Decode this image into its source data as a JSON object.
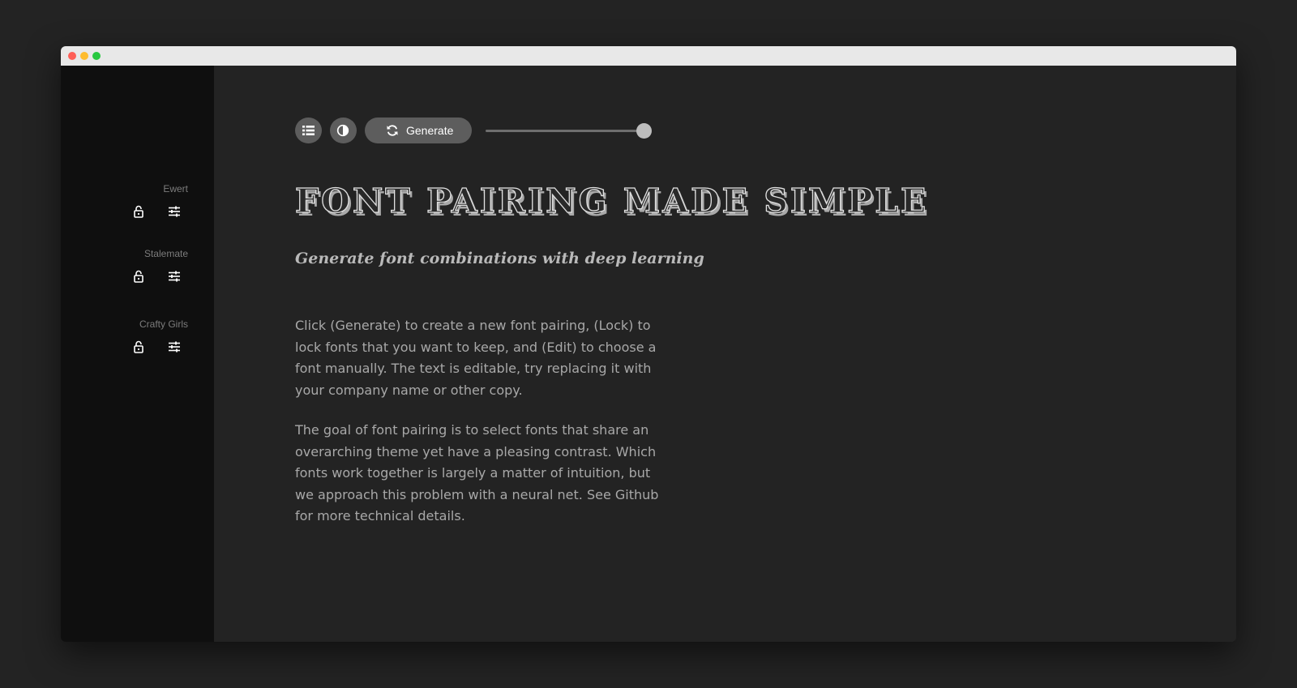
{
  "window": {
    "traffic_lights": [
      "close",
      "minimize",
      "maximize"
    ]
  },
  "sidebar": {
    "fonts": [
      {
        "name": "Ewert",
        "lock_icon": "lock-open-icon",
        "edit_icon": "sliders-icon"
      },
      {
        "name": "Stalemate",
        "lock_icon": "lock-open-icon",
        "edit_icon": "sliders-icon"
      },
      {
        "name": "Crafty Girls",
        "lock_icon": "lock-open-icon",
        "edit_icon": "sliders-icon"
      }
    ]
  },
  "toolbar": {
    "list_icon": "list-icon",
    "contrast_icon": "contrast-icon",
    "generate_icon": "refresh-icon",
    "generate_label": "Generate",
    "slider_value_fraction": 0.95
  },
  "content": {
    "headline": "FONT PAIRING MADE SIMPLE",
    "subheadline": "Generate font combinations with deep learning",
    "paragraphs": [
      "Click (Generate) to create a new font pairing, (Lock) to lock fonts that you want to keep, and (Edit) to choose a font manually. The text is editable, try replacing it with your company name or other copy.",
      "The goal of font pairing is to select fonts that share an overarching theme yet have a pleasing contrast. Which fonts work together is largely a matter of intuition, but we approach this problem with a neural net. See Github for more technical details."
    ]
  },
  "colors": {
    "page_background": "#232323",
    "sidebar_background": "#0f0f0f",
    "button_background": "#5d5d5d",
    "body_text": "#a8a8a8",
    "sidebar_label": "#7c7c7c"
  }
}
